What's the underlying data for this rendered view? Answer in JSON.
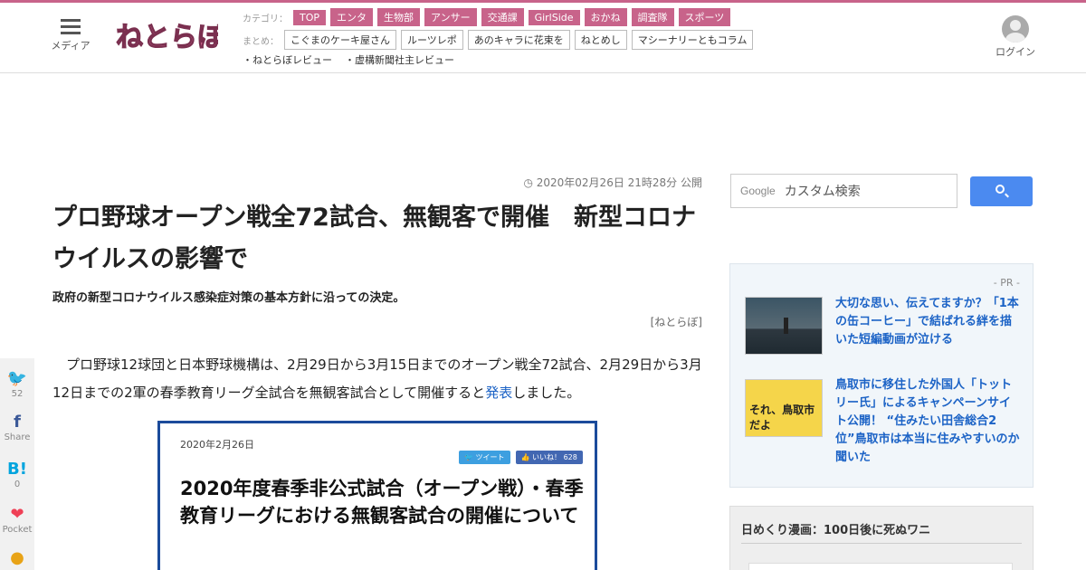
{
  "header": {
    "menu_label": "メディア",
    "login_label": "ログイン",
    "categories_head": "カテゴリ：",
    "categories": [
      "TOP",
      "エンタ",
      "生物部",
      "アンサー",
      "交通課",
      "GirlSide",
      "おかね",
      "調査隊",
      "スポーツ"
    ],
    "summary_head": "まとめ：",
    "summaries": [
      "こぐまのケーキ屋さん",
      "ルーツレポ",
      "あのキャラに花束を",
      "ねとめし",
      "マシーナリーともコラム"
    ],
    "reviews": [
      "・ねとらぼレビュー",
      "・虚構新聞社主レビュー"
    ],
    "brand_color": "#c8638a"
  },
  "article": {
    "date": "2020年02月26日 21時28分 公開",
    "title": "プロ野球オープン戦全72試合、無観客で開催　新型コロナウイルスの影響で",
    "subtitle": "政府の新型コロナウイルス感染症対策の基本方針に沿っての決定。",
    "byline": "[ねとらぼ]",
    "body_before_link": "プロ野球12球団と日本野球機構は、2月29日から3月15日までのオープン戦全72試合、2月29日から3月12日までの2軍の春季教育リーグ全試合を無観客試合として開催すると",
    "body_link": "発表",
    "body_after_link": "しました。",
    "link_color": "#1c63c6"
  },
  "share": [
    {
      "icon": "twitter-icon",
      "glyph": "🐦",
      "count": "52"
    },
    {
      "icon": "facebook-icon",
      "glyph": "f",
      "count": "Share"
    },
    {
      "icon": "hatena-icon",
      "glyph": "B!",
      "count": "0"
    },
    {
      "icon": "pocket-icon",
      "glyph": "❤",
      "count": "Pocket"
    },
    {
      "icon": "line-icon",
      "glyph": "●",
      "count": ""
    }
  ],
  "embed": {
    "date": "2020年2月26日",
    "tweet_label": "ツイート",
    "like_label": "いいね！ 628",
    "title": "2020年度春季非公式試合（オープン戦）・春季教育リーグにおける無観客試合の開催について"
  },
  "sidebar": {
    "search_brand": "Google",
    "search_placeholder": "カスタム検索",
    "pr_label": "- PR -",
    "pr_items": [
      {
        "text": "大切な思い、伝えてますか？「1本の缶コーヒー」で結ばれる絆を描いた短編動画が泣ける"
      },
      {
        "text": "鳥取市に移住した外国人「トットリー氏」によるキャンペーンサイト公開！ “住みたい田舎総合2位”鳥取市は本当に住みやすいのか聞いた",
        "thumb_text": "それ、鳥取市だよ"
      }
    ],
    "manga_title": "日めくり漫画：100日後に死ぬワニ"
  }
}
